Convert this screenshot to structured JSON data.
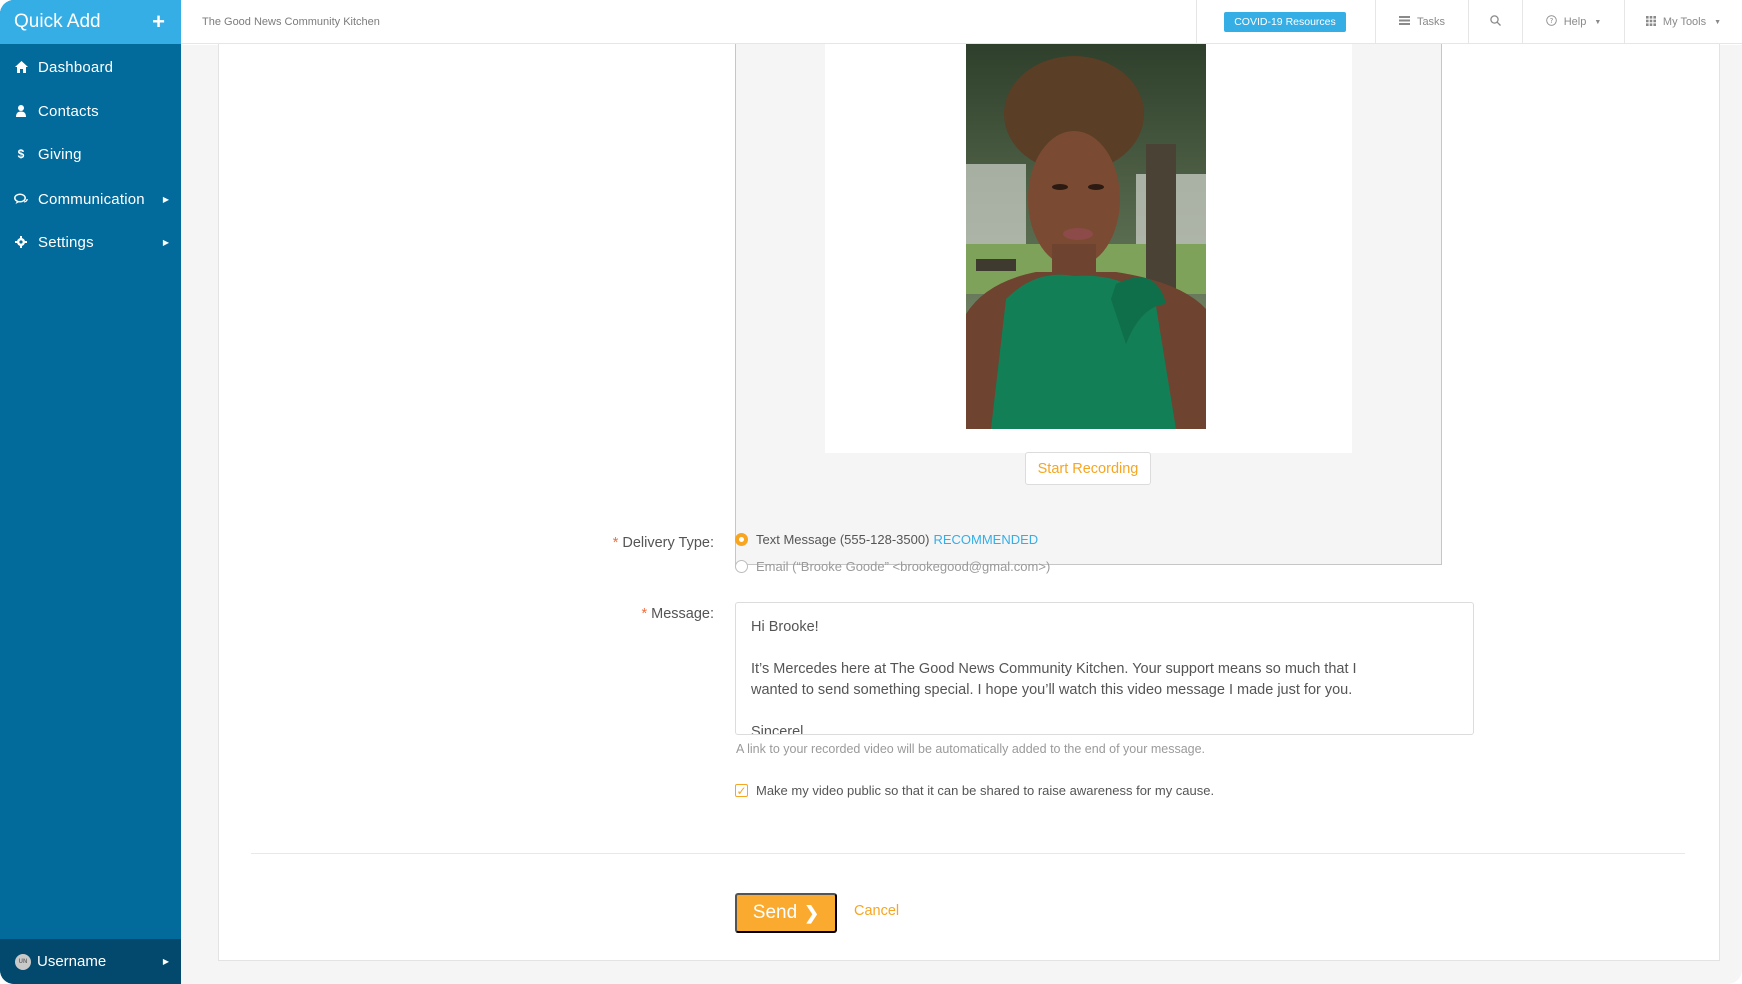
{
  "sidebar": {
    "quick_add_label": "Quick Add",
    "quick_add_icon": "plus-icon",
    "items": [
      {
        "label": "Dashboard",
        "icon": "home-icon",
        "has_submenu": false
      },
      {
        "label": "Contacts",
        "icon": "user-icon",
        "has_submenu": false
      },
      {
        "label": "Giving",
        "icon": "dollar-icon",
        "has_submenu": false
      },
      {
        "label": "Communication",
        "icon": "chat-icon",
        "has_submenu": true
      },
      {
        "label": "Settings",
        "icon": "gear-icon",
        "has_submenu": true
      }
    ],
    "user": {
      "initials": "UN",
      "label": "Username"
    }
  },
  "header": {
    "org_name": "The Good News Community Kitchen",
    "covid_label": "COVID-19 Resources",
    "tasks_label": "Tasks",
    "help_label": "Help",
    "tools_label": "My Tools"
  },
  "recorder": {
    "start_label": "Start Recording"
  },
  "form": {
    "delivery_label": "Delivery Type:",
    "delivery_options": [
      {
        "label": "Text Message (555-128-3500)",
        "badge": "RECOMMENDED",
        "selected": true
      },
      {
        "label": "Email (“Brooke Goode” <brookegood@gmal.com>)",
        "badge": "",
        "selected": false
      }
    ],
    "message_label": "Message:",
    "message_value": "Hi Brooke!\n\nIt’s Mercedes here at The Good News Community Kitchen. Your support means so much that I\nwanted to send something special. I hope you’ll watch this video message I made just for you.\n\nSincerel",
    "help_text": "A link to your recorded video will be automatically added to the end of your message.",
    "public_checkbox_label": "Make my video public so that it can be shared to raise awareness for my cause.",
    "public_checked": true,
    "send_label": "Send",
    "cancel_label": "Cancel"
  },
  "colors": {
    "sidebar": "#026b9c",
    "quick_add": "#35aee6",
    "accent_orange": "#f9aa2f",
    "link_blue": "#35aee6"
  }
}
